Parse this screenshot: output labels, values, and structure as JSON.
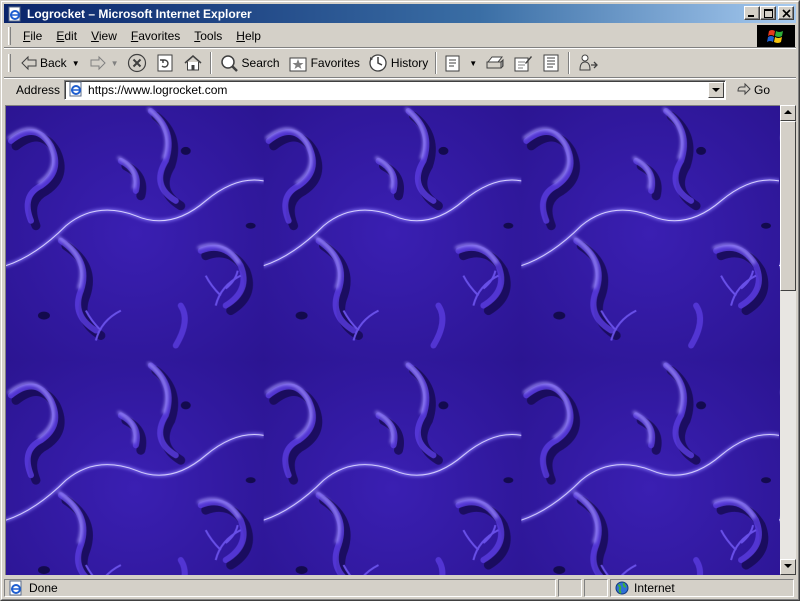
{
  "window": {
    "title": "Logrocket – Microsoft Internet Explorer"
  },
  "menu": {
    "items": [
      {
        "label": "File",
        "accel": "F",
        "rest": "ile"
      },
      {
        "label": "Edit",
        "accel": "E",
        "rest": "dit"
      },
      {
        "label": "View",
        "accel": "V",
        "rest": "iew"
      },
      {
        "label": "Favorites",
        "accel": "F",
        "rest": "avorites"
      },
      {
        "label": "Tools",
        "accel": "T",
        "rest": "ools"
      },
      {
        "label": "Help",
        "accel": "H",
        "rest": "elp"
      }
    ]
  },
  "toolbar": {
    "back_label": "Back",
    "search_label": "Search",
    "favorites_label": "Favorites",
    "history_label": "History"
  },
  "address": {
    "label": "Address",
    "url": "https://www.logrocket.com",
    "go_label": "Go"
  },
  "status": {
    "text": "Done",
    "zone": "Internet"
  },
  "colors": {
    "page_background": "#3e1fb0",
    "highlight": "#9b8cff",
    "shadow": "#160a52"
  },
  "icons": [
    "ie-page-icon",
    "minimize-icon",
    "maximize-icon",
    "close-icon",
    "windows-logo-icon",
    "back-arrow-icon",
    "forward-arrow-icon",
    "stop-icon",
    "refresh-icon",
    "home-icon",
    "search-icon",
    "favorites-icon",
    "history-icon",
    "mail-icon",
    "print-icon",
    "edit-icon",
    "discuss-icon",
    "messenger-icon",
    "go-arrow-icon",
    "globe-icon"
  ]
}
